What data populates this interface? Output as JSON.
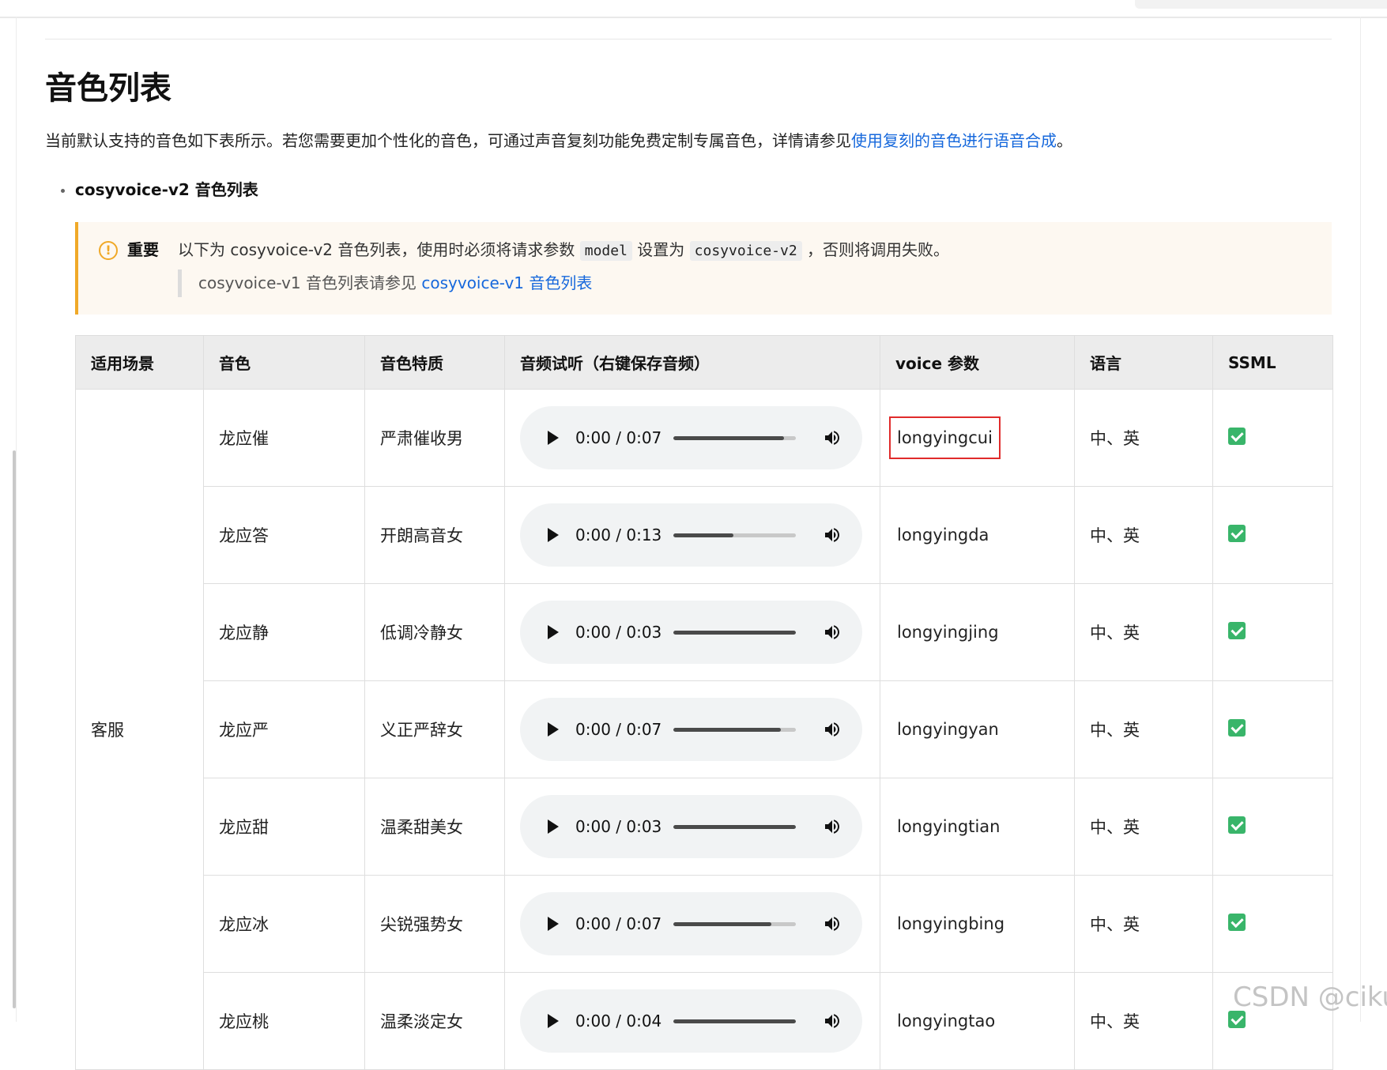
{
  "page": {
    "title": "音色列表",
    "intro_text": "当前默认支持的音色如下表所示。若您需要更加个性化的音色，可通过声音复刻功能免费定制专属音色，详情请参见",
    "intro_link": "使用复刻的音色进行语音合成",
    "intro_suffix": "。",
    "bullet": "cosyvoice-v2 音色列表"
  },
  "notice": {
    "icon": "warning-circle-icon",
    "label": "重要",
    "text_1": "以下为 cosyvoice-v2 音色列表，使用时必须将请求参数",
    "code_1": "model",
    "text_2": "设置为",
    "code_2": "cosyvoice-v2",
    "text_3": "，否则将调用失败。",
    "quote_text": "cosyvoice-v1 音色列表请参见",
    "quote_link": "cosyvoice-v1 音色列表"
  },
  "colors": {
    "link": "#1668dc",
    "warning_accent": "#f0a928",
    "highlight_box": "#e02b2b",
    "check_green": "#39b56a"
  },
  "table": {
    "headers": [
      "适用场景",
      "音色",
      "音色特质",
      "音频试听（右键保存音频）",
      "voice 参数",
      "语言",
      "SSML"
    ],
    "scene": "客服",
    "rows": [
      {
        "name": "龙应催",
        "trait": "严肃催收男",
        "time": "0:00 / 0:07",
        "progress": 0.9,
        "voice": "longyingcui",
        "lang": "中、英",
        "ssml": true,
        "highlighted": true
      },
      {
        "name": "龙应答",
        "trait": "开朗高音女",
        "time": "0:00 / 0:13",
        "progress": 0.49,
        "voice": "longyingda",
        "lang": "中、英",
        "ssml": true,
        "highlighted": false
      },
      {
        "name": "龙应静",
        "trait": "低调冷静女",
        "time": "0:00 / 0:03",
        "progress": 1.0,
        "voice": "longyingjing",
        "lang": "中、英",
        "ssml": true,
        "highlighted": false
      },
      {
        "name": "龙应严",
        "trait": "义正严辞女",
        "time": "0:00 / 0:07",
        "progress": 0.88,
        "voice": "longyingyan",
        "lang": "中、英",
        "ssml": true,
        "highlighted": false
      },
      {
        "name": "龙应甜",
        "trait": "温柔甜美女",
        "time": "0:00 / 0:03",
        "progress": 1.0,
        "voice": "longyingtian",
        "lang": "中、英",
        "ssml": true,
        "highlighted": false
      },
      {
        "name": "龙应冰",
        "trait": "尖锐强势女",
        "time": "0:00 / 0:07",
        "progress": 0.8,
        "voice": "longyingbing",
        "lang": "中、英",
        "ssml": true,
        "highlighted": false
      },
      {
        "name": "龙应桃",
        "trait": "温柔淡定女",
        "time": "0:00 / 0:04",
        "progress": 1.0,
        "voice": "longyingtao",
        "lang": "中、英",
        "ssml": true,
        "highlighted": false
      }
    ]
  },
  "watermark": "CSDN @ciku"
}
